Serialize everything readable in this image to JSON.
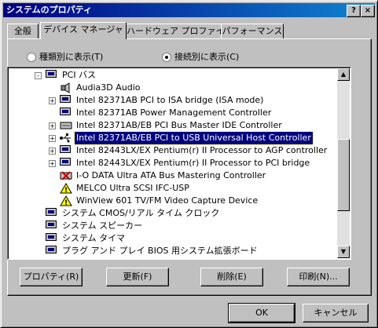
{
  "window": {
    "title": "システムのプロパティ",
    "help_btn": "?",
    "close_btn": "×"
  },
  "tabs": [
    {
      "label": "全般",
      "active": false
    },
    {
      "label": "デバイス マネージャ",
      "active": true
    },
    {
      "label": "ハードウェア プロファイル",
      "active": false
    },
    {
      "label": "パフォーマンス",
      "active": false
    }
  ],
  "view_options": {
    "by_type": "種類別に表示(T)",
    "by_connection": "接続別に表示(C)",
    "selected": "by_connection"
  },
  "tree": [
    {
      "label": "PCI バス",
      "icon": "pci-bus-icon",
      "expander": "-",
      "selected": false
    },
    {
      "label": "Audia3D Audio",
      "icon": "speaker-icon",
      "expander": "",
      "selected": false
    },
    {
      "label": "Intel 82371AB PCI to ISA bridge (ISA mode)",
      "icon": "computer-icon",
      "expander": "+",
      "selected": false
    },
    {
      "label": "Intel 82371AB Power Management Controller",
      "icon": "computer-icon",
      "expander": "",
      "selected": false
    },
    {
      "label": "Intel 82371AB/EB PCI Bus Master IDE Controller",
      "icon": "disk-controller-icon",
      "expander": "+",
      "selected": false
    },
    {
      "label": "Intel 82371AB/EB PCI to USB Universal Host Controller",
      "icon": "usb-icon",
      "expander": "+",
      "selected": true
    },
    {
      "label": "Intel 82443LX/EX Pentium(r) II Processor to AGP controller",
      "icon": "computer-icon",
      "expander": "+",
      "selected": false
    },
    {
      "label": "Intel 82443LX/EX Pentium(r) II Processor to PCI bridge",
      "icon": "computer-icon",
      "expander": "+",
      "selected": false
    },
    {
      "label": "I-O DATA Ultra ATA Bus Mastering Controller",
      "icon": "disabled-controller-icon",
      "expander": "",
      "selected": false
    },
    {
      "label": "MELCO Ultra SCSI IFC-USP",
      "icon": "warning-scsi-icon",
      "expander": "",
      "selected": false
    },
    {
      "label": "WinView 601 TV/FM Video Capture Device",
      "icon": "warning-video-icon",
      "expander": "",
      "selected": false
    },
    {
      "label": "システム CMOS/リアル タイム クロック",
      "icon": "computer-icon",
      "expander": "",
      "selected": false
    },
    {
      "label": "システム スピーカー",
      "icon": "computer-icon",
      "expander": "",
      "selected": false
    },
    {
      "label": "システム タイマ",
      "icon": "computer-icon",
      "expander": "",
      "selected": false
    },
    {
      "label": "プラグ アンド プレイ BIOS 用システム拡張ボード",
      "icon": "computer-icon",
      "expander": "",
      "selected": false
    }
  ],
  "buttons": {
    "properties": "プロパティ(R)",
    "refresh": "更新(F)",
    "remove": "削除(E)",
    "print": "印刷(N)...",
    "ok": "OK",
    "cancel": "キャンセル"
  }
}
